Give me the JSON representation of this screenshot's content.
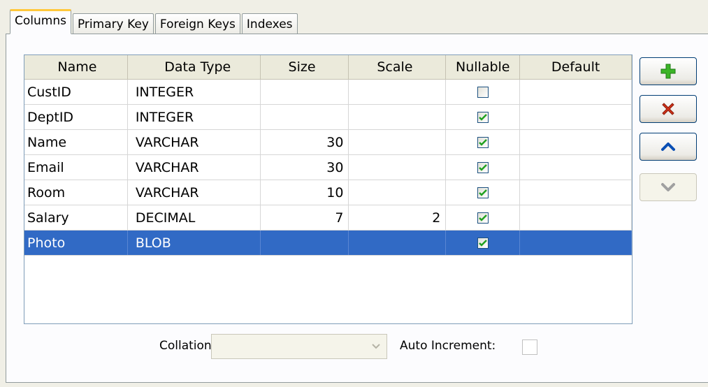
{
  "tabs": [
    {
      "label": "Columns",
      "active": true
    },
    {
      "label": "Primary Key",
      "active": false
    },
    {
      "label": "Foreign Keys",
      "active": false
    },
    {
      "label": "Indexes",
      "active": false
    }
  ],
  "grid": {
    "headers": {
      "name": "Name",
      "type": "Data Type",
      "size": "Size",
      "scale": "Scale",
      "nullable": "Nullable",
      "default": "Default"
    },
    "rows": [
      {
        "name": "CustID",
        "type": "INTEGER",
        "size": "",
        "scale": "",
        "nullable": false,
        "default": ""
      },
      {
        "name": "DeptID",
        "type": "INTEGER",
        "size": "",
        "scale": "",
        "nullable": true,
        "default": ""
      },
      {
        "name": "Name",
        "type": "VARCHAR",
        "size": "30",
        "scale": "",
        "nullable": true,
        "default": ""
      },
      {
        "name": "Email",
        "type": "VARCHAR",
        "size": "30",
        "scale": "",
        "nullable": true,
        "default": ""
      },
      {
        "name": "Room",
        "type": "VARCHAR",
        "size": "10",
        "scale": "",
        "nullable": true,
        "default": ""
      },
      {
        "name": "Salary",
        "type": "DECIMAL",
        "size": "7",
        "scale": "2",
        "nullable": true,
        "default": ""
      },
      {
        "name": "Photo",
        "type": "BLOB",
        "size": "",
        "scale": "",
        "nullable": true,
        "default": "",
        "selected": true
      }
    ]
  },
  "buttons": {
    "add": {
      "icon": "plus-icon",
      "color": "#3cb428"
    },
    "delete": {
      "icon": "x-icon",
      "color": "#d23218"
    },
    "move_up": {
      "icon": "chevron-up-icon",
      "color": "#0a4fb4"
    },
    "move_down": {
      "icon": "chevron-down-icon",
      "color": "#a0a0a0",
      "disabled": true
    }
  },
  "bottom": {
    "collation_label": "Collation:",
    "collation_value": "",
    "auto_increment_label": "Auto Increment:",
    "auto_increment_checked": false
  },
  "colors": {
    "selection": "#316ac5",
    "active_tab_accent": "#ffc83c",
    "checkbox_check": "#21a121"
  }
}
